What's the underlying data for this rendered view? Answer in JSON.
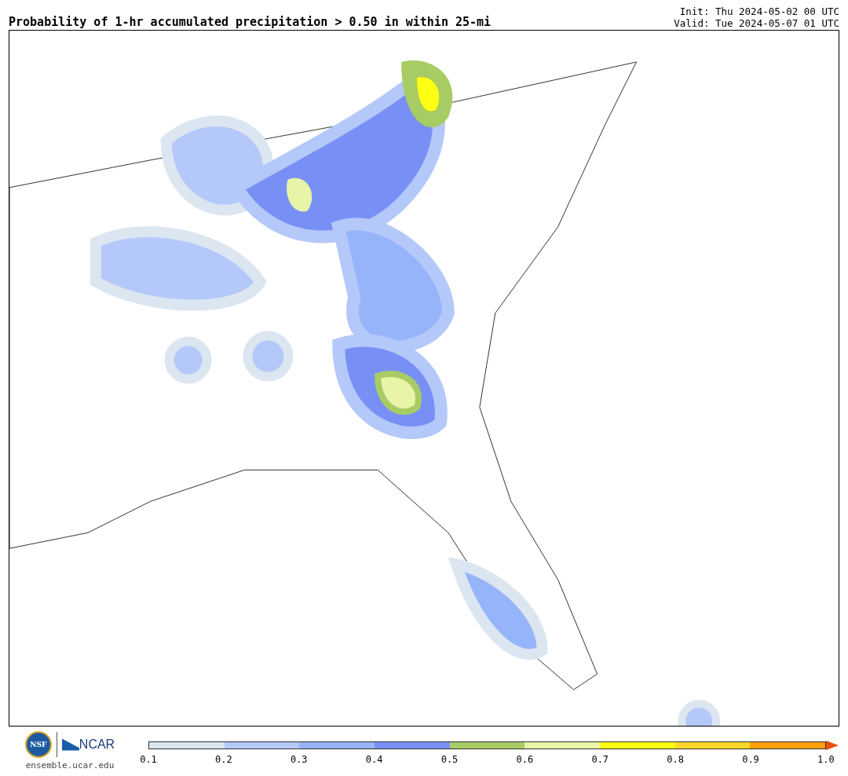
{
  "title": "Probability of 1-hr accumulated precipitation > 0.50 in within 25-mi",
  "init": "Init: Thu 2024-05-02 00 UTC",
  "valid": "Valid: Tue 2024-05-07 01 UTC",
  "logos": {
    "nsf": "NSF",
    "ncar": "NCAR",
    "url": "ensemble.ucar.edu"
  },
  "colorbar": {
    "segments": [
      {
        "color": "#dce6f0"
      },
      {
        "color": "#b4c8fa"
      },
      {
        "color": "#96b4fa"
      },
      {
        "color": "#7890f5"
      },
      {
        "color": "#a8cc64"
      },
      {
        "color": "#e8f5a8"
      },
      {
        "color": "#ffff14"
      },
      {
        "color": "#ffd72a"
      },
      {
        "color": "#ffa00a"
      }
    ],
    "extend": {
      "color": "#e8500a"
    },
    "ticks": [
      "0.1",
      "0.2",
      "0.3",
      "0.4",
      "0.5",
      "0.6",
      "0.7",
      "0.8",
      "0.9",
      "1.0"
    ]
  }
}
